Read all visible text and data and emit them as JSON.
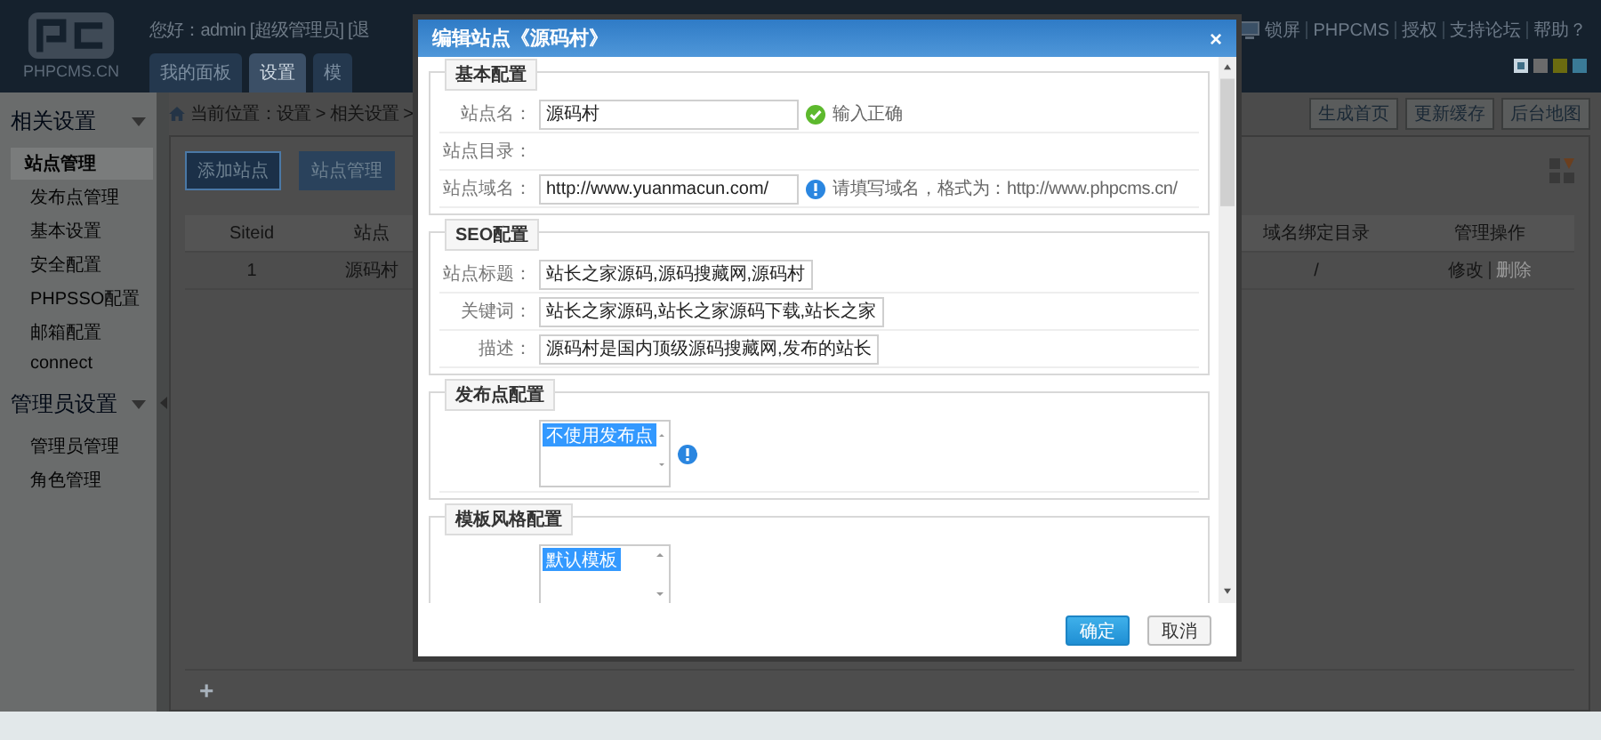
{
  "header": {
    "logo_text": "PHPCMS.CN",
    "greeting": "您好：admin [超级管理员] [退",
    "tabs": [
      {
        "label": "我的面板",
        "selected": false
      },
      {
        "label": "设置",
        "selected": true
      },
      {
        "label": "模",
        "selected": false
      }
    ],
    "links": [
      "锁屏",
      "PHPCMS",
      "授权",
      "支持论坛",
      "帮助？"
    ],
    "theme_swatches": [
      {
        "color": "#3f6e86",
        "selected": true
      },
      {
        "color": "#6b6b6b",
        "selected": false
      },
      {
        "color": "#6b6b10",
        "selected": false
      },
      {
        "color": "#3a7a96",
        "selected": false
      }
    ]
  },
  "sidebar": {
    "sections": [
      {
        "title": "相关设置",
        "items": [
          {
            "label": "站点管理",
            "selected": true
          },
          {
            "label": "发布点管理",
            "selected": false
          },
          {
            "label": "基本设置",
            "selected": false
          },
          {
            "label": "安全配置",
            "selected": false
          },
          {
            "label": "PHPSSO配置",
            "selected": false
          },
          {
            "label": "邮箱配置",
            "selected": false
          },
          {
            "label": "connect",
            "selected": false
          }
        ]
      },
      {
        "title": "管理员设置",
        "items": [
          {
            "label": "管理员管理",
            "selected": false
          },
          {
            "label": "角色管理",
            "selected": false
          }
        ]
      }
    ]
  },
  "breadcrumb": "当前位置：设置 > 相关设置 >",
  "toolbar_buttons": [
    "生成首页",
    "更新缓存",
    "后台地图"
  ],
  "actions": [
    {
      "label": "添加站点",
      "selected": true
    },
    {
      "label": "站点管理",
      "selected": false
    }
  ],
  "table": {
    "columns": [
      "Siteid",
      "站点",
      "域名绑定目录",
      "管理操作"
    ],
    "rows": [
      {
        "cells": [
          "1",
          "源码村",
          "/"
        ],
        "actions": [
          {
            "label": "修改",
            "disabled": false
          },
          {
            "label": "删除",
            "disabled": true
          }
        ]
      }
    ]
  },
  "add_symbol": "+",
  "dialog": {
    "title": "编辑站点《源码村》",
    "close": "×",
    "sections": [
      {
        "legend": "基本配置",
        "rows": [
          {
            "kind": "input",
            "label": "站点名：",
            "value": "源码村",
            "hint": {
              "kind": "ok",
              "text": "输入正确"
            }
          },
          {
            "kind": "text",
            "label": "站点目录："
          },
          {
            "kind": "input",
            "label": "站点域名：",
            "value": "http://www.yuanmacun.com/",
            "hint": {
              "kind": "info",
              "text": "请填写域名，格式为：http://www.phpcms.cn/"
            }
          }
        ]
      },
      {
        "legend": "SEO配置",
        "rows": [
          {
            "kind": "input",
            "label": "站点标题：",
            "value": "站长之家源码,源码搜藏网,源码村"
          },
          {
            "kind": "input",
            "label": "关键词：",
            "value": "站长之家源码,站长之家源码下载,站长之家"
          },
          {
            "kind": "input",
            "label": "描述：",
            "value": "源码村是国内顶级源码搜藏网,发布的站长"
          }
        ]
      },
      {
        "legend": "发布点配置",
        "rows": [
          {
            "kind": "list",
            "options": [
              {
                "label": "不使用发布点",
                "selected": true
              }
            ],
            "hint": {
              "kind": "info"
            }
          }
        ]
      },
      {
        "legend": "模板风格配置",
        "rows": [
          {
            "kind": "list",
            "options": [
              {
                "label": "默认模板",
                "selected": true
              }
            ]
          }
        ]
      }
    ],
    "buttons": [
      {
        "label": "确定",
        "kind": "primary"
      },
      {
        "label": "取消",
        "kind": "default"
      }
    ]
  }
}
